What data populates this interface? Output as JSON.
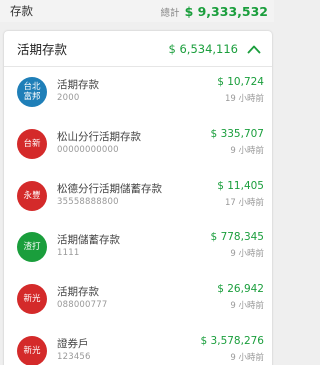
{
  "header": {
    "title": "存款",
    "total_label": "總計",
    "total_value": "$ 9,333,532"
  },
  "section": {
    "title": "活期存款",
    "total": "$ 6,534,116"
  },
  "accounts": [
    {
      "badge": "台北\n富邦",
      "badge_color": "#1f7fb8",
      "name": "活期存款",
      "number": "2000",
      "amount": "$ 10,724",
      "time": "19 小時前"
    },
    {
      "badge": "台新",
      "badge_color": "#d42a2a",
      "name": "松山分行活期存款",
      "number": "00000000000",
      "amount": "$ 335,707",
      "time": "9 小時前"
    },
    {
      "badge": "永豐",
      "badge_color": "#d42a2a",
      "name": "松德分行活期儲蓄存款",
      "number": "35558888800",
      "amount": "$ 11,405",
      "time": "17 小時前"
    },
    {
      "badge": "渣打",
      "badge_color": "#1a9e3c",
      "name": "活期儲蓄存款",
      "number": "1111",
      "amount": "$ 778,345",
      "time": "9 小時前"
    },
    {
      "badge": "新光",
      "badge_color": "#d42a2a",
      "name": "活期存款",
      "number": "088000777",
      "amount": "$ 26,942",
      "time": "9 小時前"
    },
    {
      "badge": "新光",
      "badge_color": "#d42a2a",
      "name": "證券戶",
      "number": "123456",
      "amount": "$ 3,578,276",
      "time": "9 小時前"
    }
  ]
}
